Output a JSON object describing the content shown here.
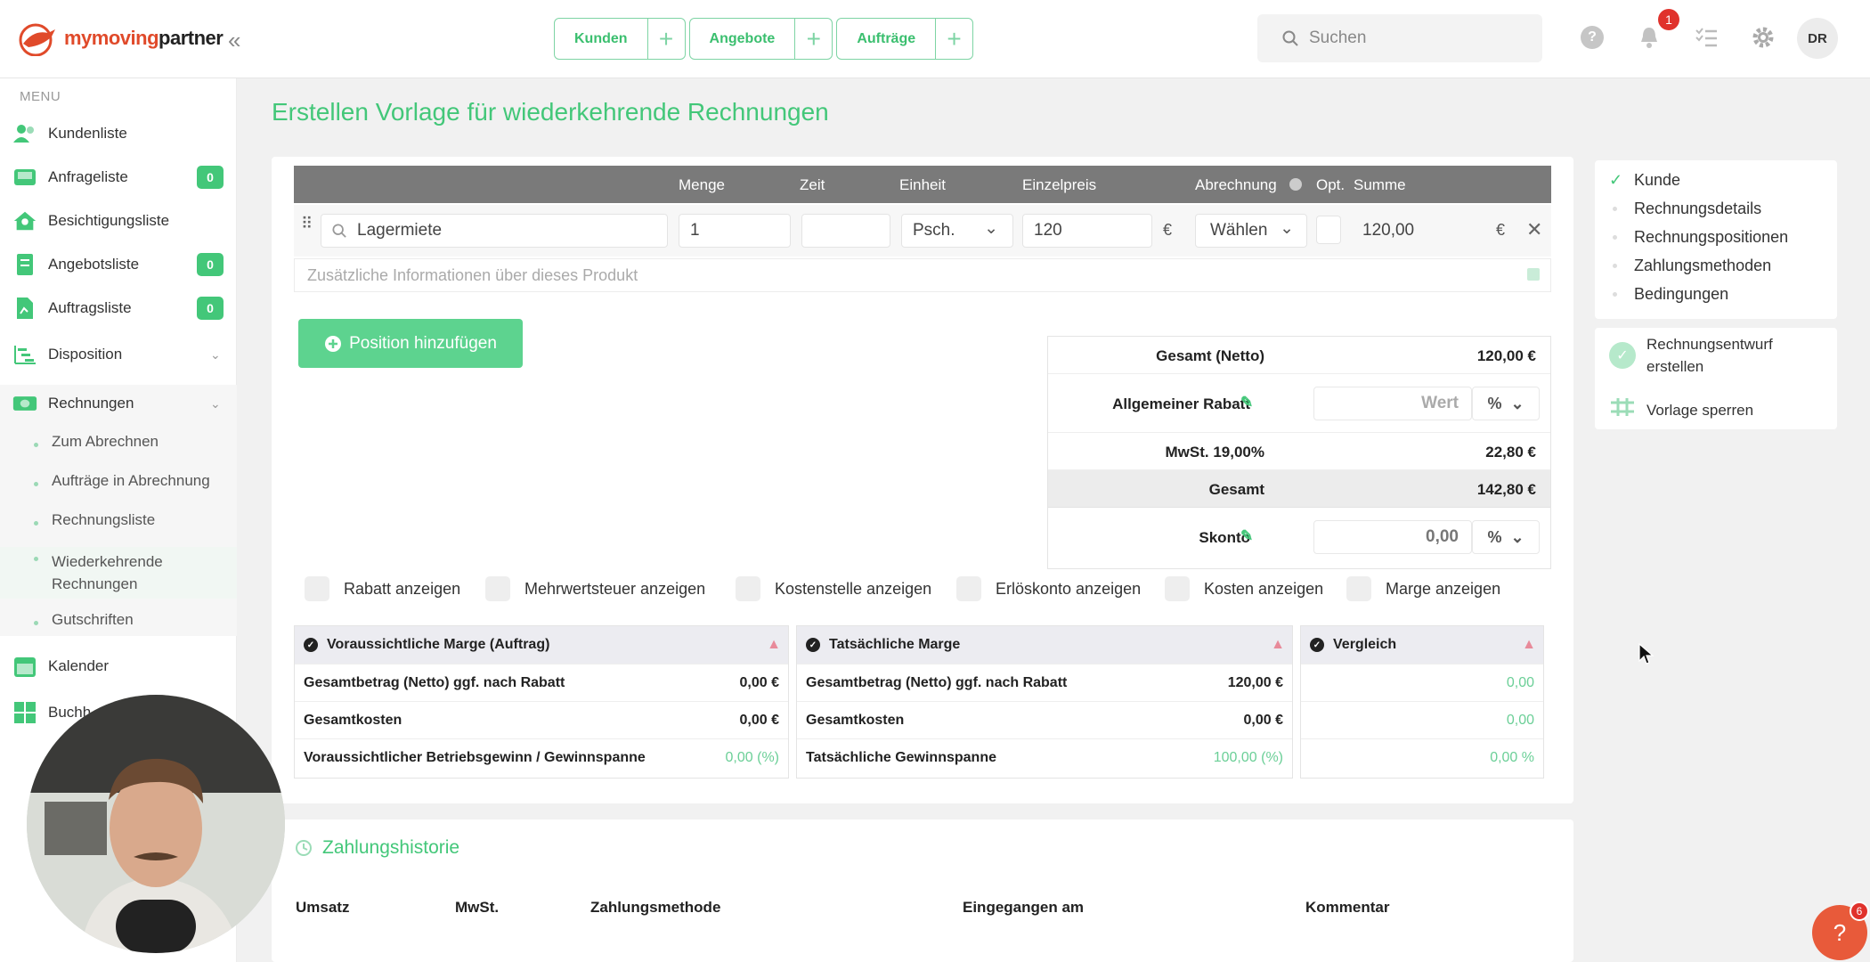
{
  "brand": {
    "name_part1": "mymoving",
    "name_part2": "partner"
  },
  "header": {
    "quick_tabs": [
      {
        "label": "Kunden"
      },
      {
        "label": "Angebote"
      },
      {
        "label": "Aufträge"
      }
    ],
    "search_placeholder": "Suchen",
    "notification_count": "1",
    "avatar_initials": "DR"
  },
  "sidebar": {
    "menu_label": "MENU",
    "items": [
      {
        "label": "Kundenliste",
        "icon": "users-icon"
      },
      {
        "label": "Anfrageliste",
        "icon": "inbox-icon",
        "count": "0"
      },
      {
        "label": "Besichtigungsliste",
        "icon": "home-user-icon"
      },
      {
        "label": "Angebotsliste",
        "icon": "document-icon",
        "count": "0"
      },
      {
        "label": "Auftragsliste",
        "icon": "file-icon",
        "count": "0"
      },
      {
        "label": "Disposition",
        "icon": "gantt-icon"
      },
      {
        "label": "Rechnungen",
        "icon": "money-icon"
      },
      {
        "label": "Kalender",
        "icon": "calendar-icon"
      },
      {
        "label": "Buchh",
        "icon": "calculator-icon"
      }
    ],
    "rechnungen_sub": [
      {
        "label": "Zum Abrechnen"
      },
      {
        "label": "Aufträge in Abrechnung"
      },
      {
        "label": "Rechnungsliste"
      },
      {
        "label": "Wiederkehrende Rechnungen"
      },
      {
        "label": "Gutschriften"
      }
    ]
  },
  "page": {
    "title": "Erstellen Vorlage für wiederkehrende Rechnungen"
  },
  "positions": {
    "headers": {
      "menge": "Menge",
      "zeit": "Zeit",
      "einheit": "Einheit",
      "einzelpreis": "Einzelpreis",
      "abrechnung": "Abrechnung",
      "opt": "Opt.",
      "summe": "Summe"
    },
    "row": {
      "product": "Lagermiete",
      "menge": "1",
      "zeit": "",
      "einheit": "Psch.",
      "einzelpreis": "120",
      "currency": "€",
      "abrechnung": "Wählen",
      "summe": "120,00"
    },
    "info_placeholder": "Zusätzliche Informationen über dieses Produkt",
    "add_button": "Position hinzufügen"
  },
  "totals": {
    "netto_label": "Gesamt (Netto)",
    "netto_value": "120,00 €",
    "rabatt_label": "Allgemeiner Rabatt",
    "rabatt_placeholder": "Wert",
    "rabatt_unit": "%",
    "mwst_label": "MwSt. 19,00%",
    "mwst_value": "22,80 €",
    "gesamt_label": "Gesamt",
    "gesamt_value": "142,80 €",
    "skonto_label": "Skonto",
    "skonto_value": "0,00",
    "skonto_unit": "%"
  },
  "checkboxes": [
    {
      "label": "Rabatt anzeigen"
    },
    {
      "label": "Mehrwertsteuer anzeigen"
    },
    {
      "label": "Kostenstelle anzeigen"
    },
    {
      "label": "Erlöskonto anzeigen"
    },
    {
      "label": "Kosten anzeigen"
    },
    {
      "label": "Marge anzeigen"
    }
  ],
  "margins": {
    "expected": {
      "title": "Voraussichtliche Marge (Auftrag)",
      "rows": [
        {
          "label": "Gesamtbetrag (Netto) ggf. nach Rabatt",
          "value": "0,00 €"
        },
        {
          "label": "Gesamtkosten",
          "value": "0,00 €"
        },
        {
          "label": "Voraussichtlicher Betriebsgewinn / Gewinnspanne",
          "value": "0,00 (%)"
        }
      ]
    },
    "actual": {
      "title": "Tatsächliche Marge",
      "rows": [
        {
          "label": "Gesamtbetrag (Netto) ggf. nach Rabatt",
          "value": "120,00 €"
        },
        {
          "label": "Gesamtkosten",
          "value": "0,00 €"
        },
        {
          "label": "Tatsächliche Gewinnspanne",
          "value": "100,00 (%)"
        }
      ]
    },
    "compare": {
      "title": "Vergleich",
      "rows": [
        {
          "value": "0,00"
        },
        {
          "value": "0,00"
        },
        {
          "value": "0,00 %"
        }
      ]
    }
  },
  "payments": {
    "title": "Zahlungshistorie",
    "columns": [
      "Umsatz",
      "MwSt.",
      "Zahlungsmethode",
      "Eingegangen am",
      "Kommentar"
    ]
  },
  "steps": [
    "Kunde",
    "Rechnungsdetails",
    "Rechnungspositionen",
    "Zahlungsmethoden",
    "Bedingungen"
  ],
  "actions": {
    "draft_line1": "Rechnungsentwurf",
    "draft_line2": "erstellen",
    "lock": "Vorlage sperren"
  },
  "help_fab": {
    "icon": "?",
    "count": "6"
  },
  "colors": {
    "accent": "#43c779",
    "header_gray": "#7a7a7a",
    "danger": "#e0322c"
  }
}
